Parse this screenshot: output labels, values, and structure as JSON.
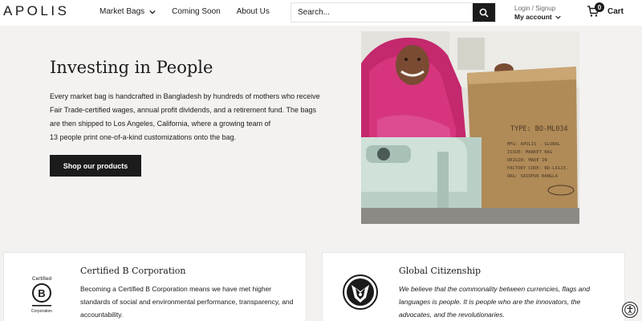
{
  "header": {
    "logo": "APOLIS",
    "nav": [
      {
        "label": "Market Bags",
        "has_dropdown": true
      },
      {
        "label": "Coming Soon",
        "has_dropdown": false
      },
      {
        "label": "About Us",
        "has_dropdown": false
      }
    ],
    "search": {
      "placeholder": "Search..."
    },
    "account": {
      "login_label": "Login / Signup",
      "account_label": "My account"
    },
    "cart": {
      "count": "0",
      "label": "Cart"
    }
  },
  "hero": {
    "title": "Investing in People",
    "lines": [
      "Every market bag is handcrafted in Bangladesh by hundreds of mothers who receive",
      "Fair Trade-certified wages, annual profit dividends, and a retirement fund. The bags",
      "are then shipped to Los Angeles, California, where a growing team of",
      "13 people print one-of-a-kind customizations onto the bag."
    ],
    "button_label": "Shop our products",
    "bag_print": {
      "type": "TYPE: BO-ML034",
      "mfg": "MFG: APOLIS - GLOBAL",
      "issue": "ISSUE: MARKET BAG",
      "origin": "ORIGIN: MADE IN",
      "factory": "FACTORY CODE: BD-LA123.",
      "org": "ORG: SAIDPUR BANGLA"
    }
  },
  "cards": [
    {
      "title": "Certified B Corporation",
      "badge_top": "Certified",
      "badge_letter": "B",
      "badge_bottom": "Corporation",
      "lines": [
        "Becoming a Certified B Corporation means we have met higher",
        "standards of social and environmental performance, transparency, and",
        "accountability."
      ]
    },
    {
      "title": "Global Citizenship",
      "lines": [
        "We believe that the commonality between currencies, flags and",
        "languages is people. It is people who are the innovators, the",
        "advocates, and the revolutionaries."
      ]
    }
  ],
  "colors": {
    "dark": "#1c1b1b",
    "hero_bg": "#f3f2f0",
    "jute": "#b08a57",
    "sari": "#d6357d"
  },
  "icons": [
    "chevron-down-icon",
    "search-icon",
    "cart-icon",
    "accessibility-icon",
    "b-corp-icon",
    "globe-emblem-icon"
  ]
}
